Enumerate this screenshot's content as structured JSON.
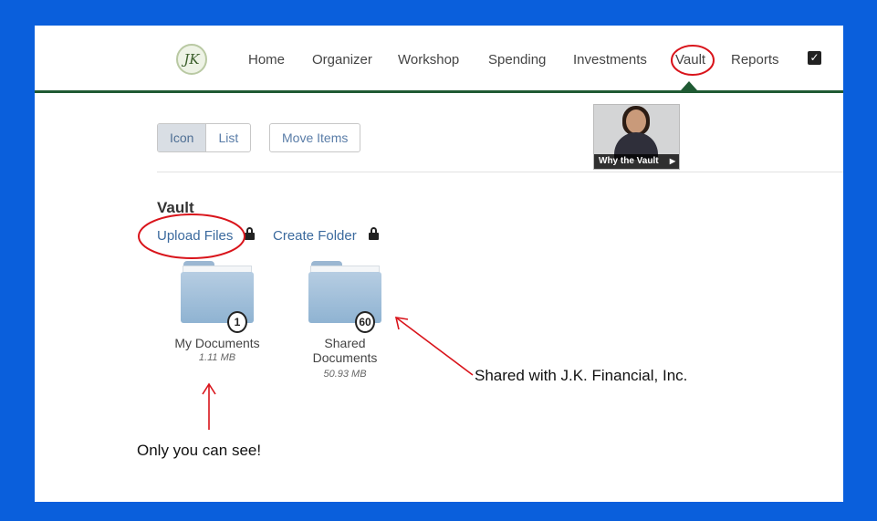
{
  "nav": {
    "logo_text": "JK",
    "items": [
      "Home",
      "Organizer",
      "Workshop",
      "Spending",
      "Investments",
      "Vault",
      "Reports"
    ],
    "active": "Vault"
  },
  "toolbar": {
    "view_icon": "Icon",
    "view_list": "List",
    "move_items": "Move Items",
    "video_caption": "Why the Vault",
    "video_play_icon": "play-icon"
  },
  "vault": {
    "title": "Vault",
    "upload_files": "Upload Files",
    "create_folder": "Create Folder",
    "folders": [
      {
        "name_line1": "My Documents",
        "name_line2": "",
        "size": "1.11 MB",
        "count": "1"
      },
      {
        "name_line1": "Shared",
        "name_line2": "Documents",
        "size": "50.93 MB",
        "count": "60"
      }
    ]
  },
  "annotations": {
    "shared_note": "Shared with J.K. Financial, Inc.",
    "private_note": "Only you can see!",
    "color": "#d9141b"
  },
  "colors": {
    "frame": "#0a5fdc",
    "nav_accent": "#1f5a33",
    "link": "#3b6a9e"
  }
}
